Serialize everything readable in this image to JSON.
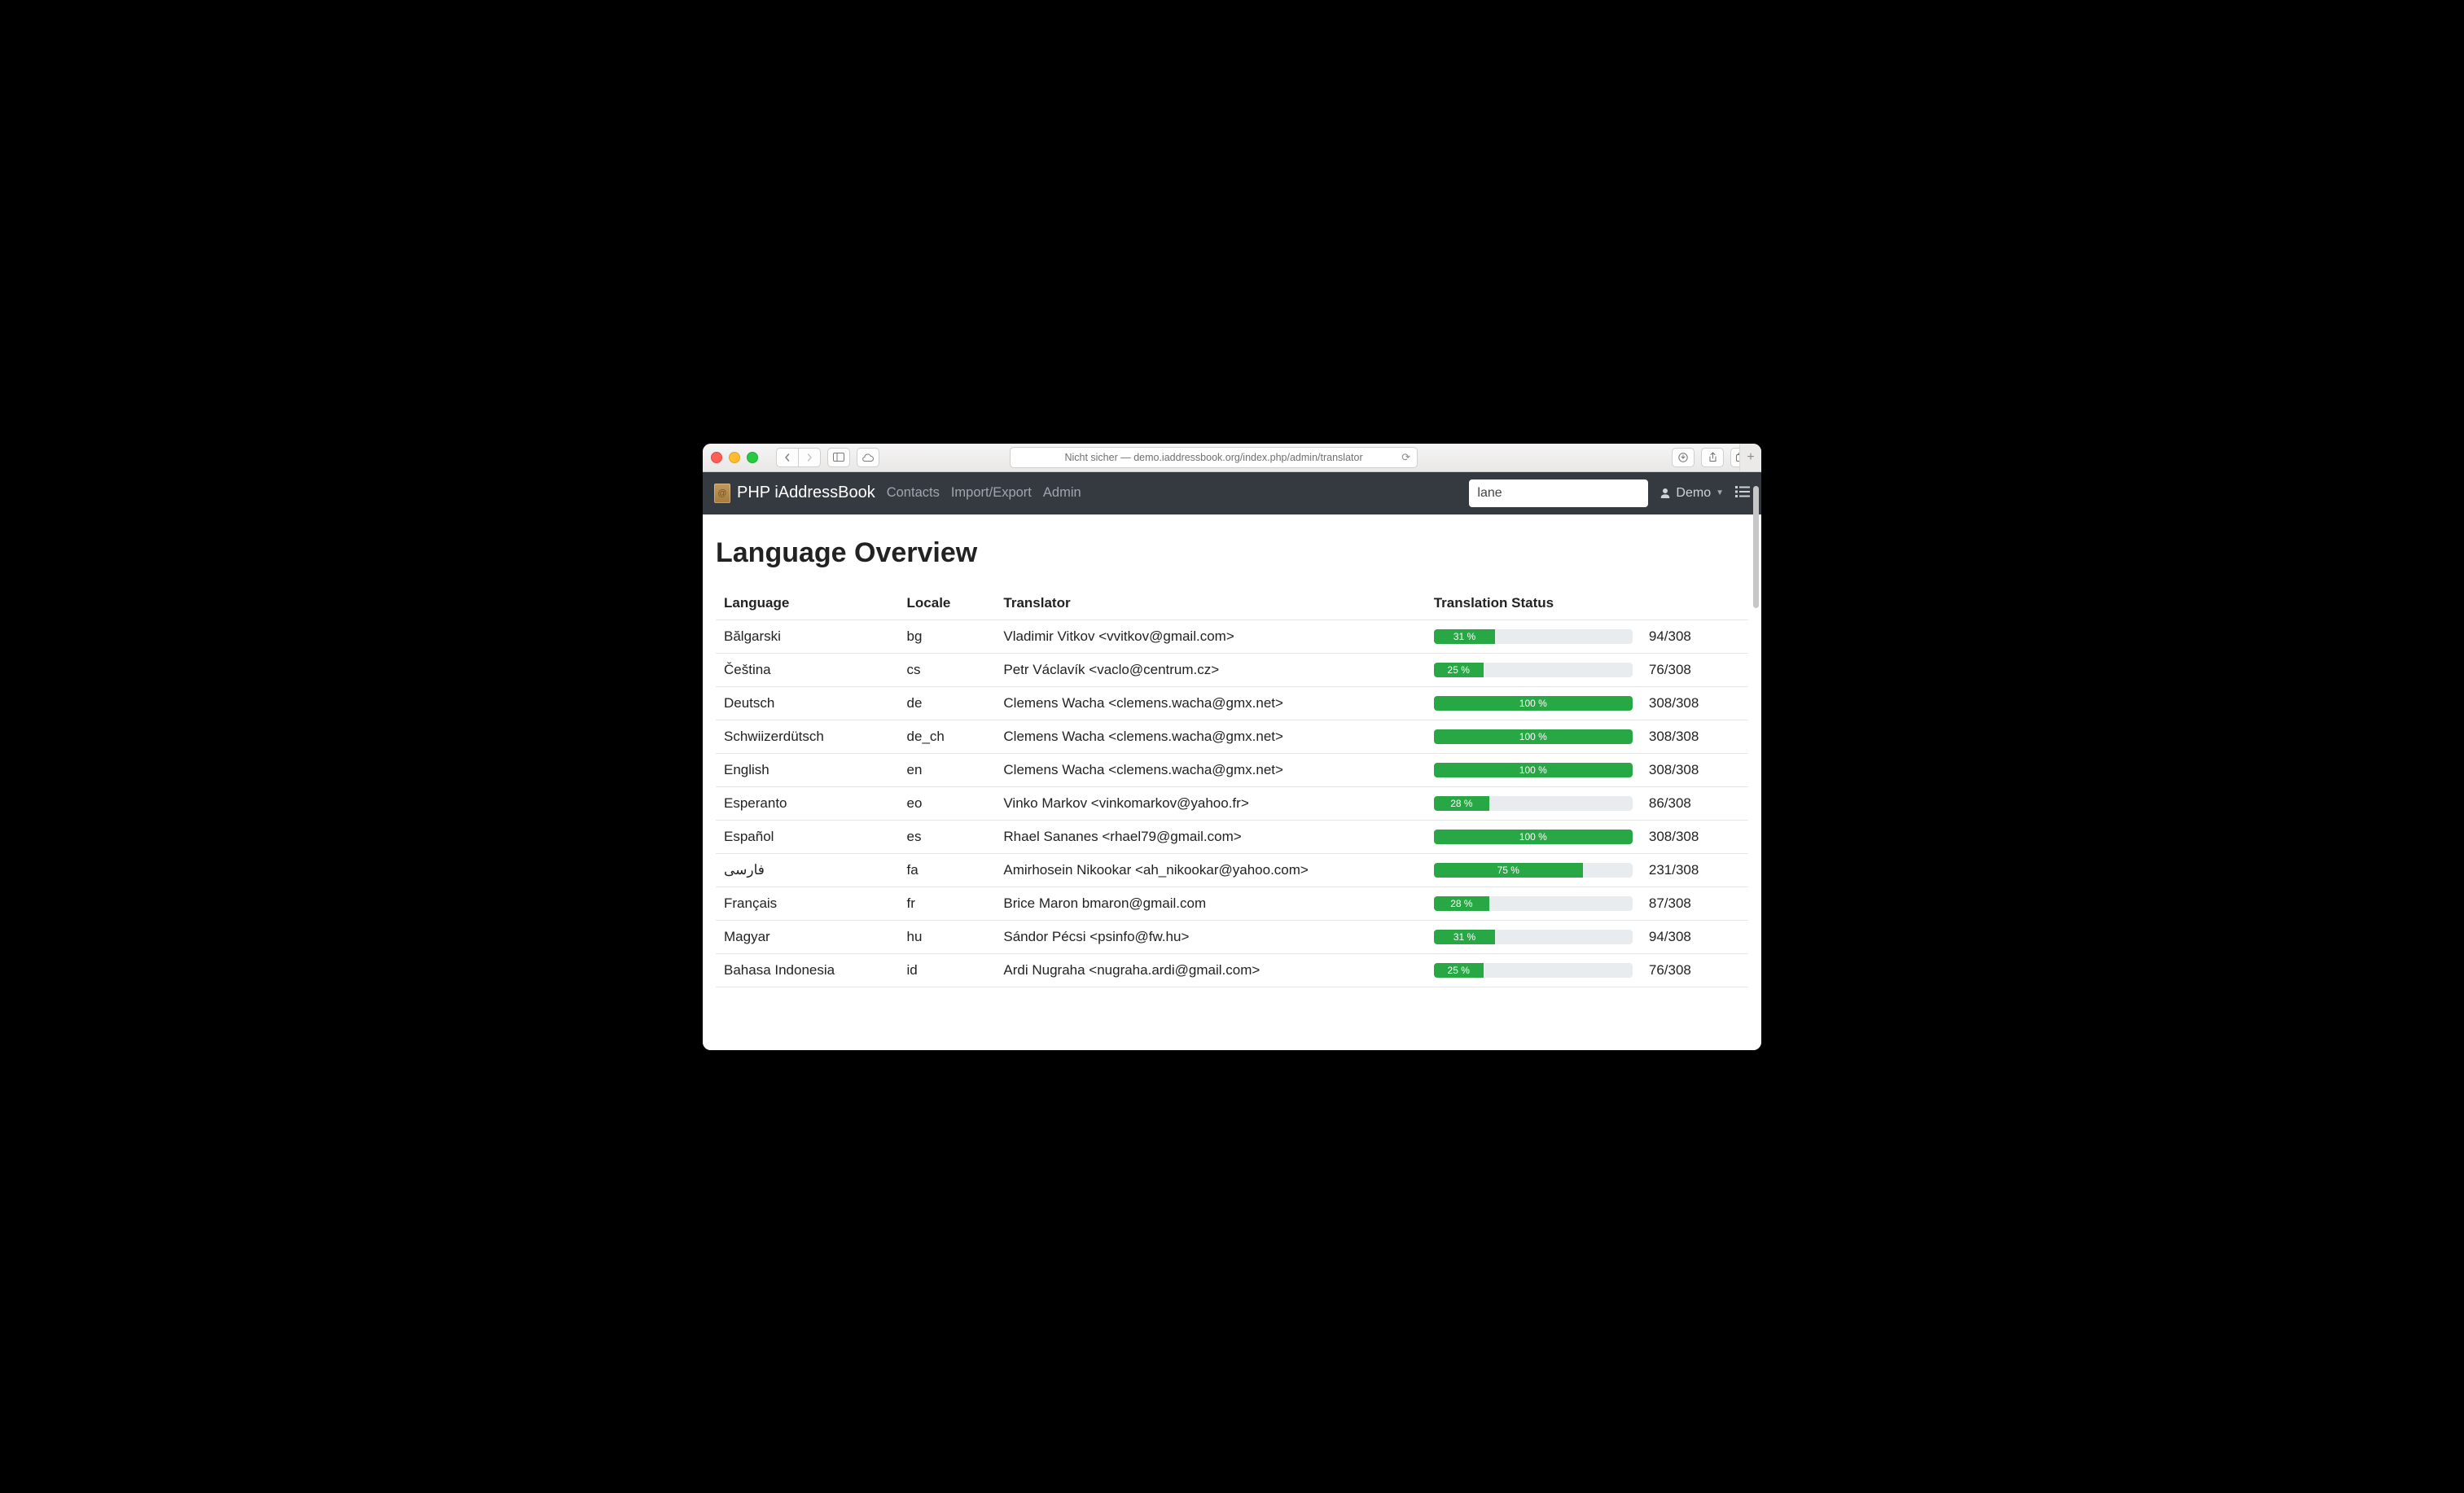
{
  "browser": {
    "address_text": "Nicht sicher — demo.iaddressbook.org/index.php/admin/translator"
  },
  "navbar": {
    "brand": "PHP iAddressBook",
    "links": [
      "Contacts",
      "Import/Export",
      "Admin"
    ],
    "search_value": "lane",
    "user_label": "Demo"
  },
  "page": {
    "title": "Language Overview",
    "columns": [
      "Language",
      "Locale",
      "Translator",
      "Translation Status"
    ]
  },
  "rows": [
    {
      "language": "Bălgarski",
      "locale": "bg",
      "translator": "Vladimir Vitkov <vvitkov@gmail.com>",
      "percent": 31,
      "percent_label": "31 %",
      "count": "94/308"
    },
    {
      "language": "Čeština",
      "locale": "cs",
      "translator": "Petr Václavík <vaclo@centrum.cz>",
      "percent": 25,
      "percent_label": "25 %",
      "count": "76/308"
    },
    {
      "language": "Deutsch",
      "locale": "de",
      "translator": "Clemens Wacha <clemens.wacha@gmx.net>",
      "percent": 100,
      "percent_label": "100 %",
      "count": "308/308"
    },
    {
      "language": "Schwiizerdütsch",
      "locale": "de_ch",
      "translator": "Clemens Wacha <clemens.wacha@gmx.net>",
      "percent": 100,
      "percent_label": "100 %",
      "count": "308/308"
    },
    {
      "language": "English",
      "locale": "en",
      "translator": "Clemens Wacha <clemens.wacha@gmx.net>",
      "percent": 100,
      "percent_label": "100 %",
      "count": "308/308"
    },
    {
      "language": "Esperanto",
      "locale": "eo",
      "translator": "Vinko Markov <vinkomarkov@yahoo.fr>",
      "percent": 28,
      "percent_label": "28 %",
      "count": "86/308"
    },
    {
      "language": "Español",
      "locale": "es",
      "translator": "Rhael Sananes <rhael79@gmail.com>",
      "percent": 100,
      "percent_label": "100 %",
      "count": "308/308"
    },
    {
      "language": "فارسی",
      "locale": "fa",
      "translator": "Amirhosein Nikookar <ah_nikookar@yahoo.com>",
      "percent": 75,
      "percent_label": "75 %",
      "count": "231/308"
    },
    {
      "language": "Français",
      "locale": "fr",
      "translator": "Brice Maron bmaron@gmail.com",
      "percent": 28,
      "percent_label": "28 %",
      "count": "87/308"
    },
    {
      "language": "Magyar",
      "locale": "hu",
      "translator": "Sándor Pécsi <psinfo@fw.hu>",
      "percent": 31,
      "percent_label": "31 %",
      "count": "94/308"
    },
    {
      "language": "Bahasa Indonesia",
      "locale": "id",
      "translator": "Ardi Nugraha <nugraha.ardi@gmail.com>",
      "percent": 25,
      "percent_label": "25 %",
      "count": "76/308"
    }
  ]
}
